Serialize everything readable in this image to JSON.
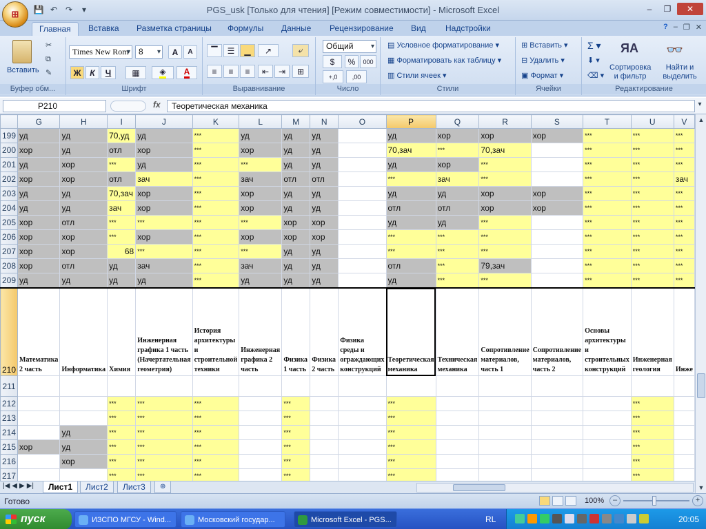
{
  "app": {
    "office_logo": "⊞",
    "title": "PGS_usk  [Только для чтения]  [Режим совместимости] - Microsoft Excel",
    "window_controls": {
      "minimize": "–",
      "restore": "❐",
      "close": "✕"
    },
    "ribbon_controls": {
      "minimize": "–",
      "restore": "❐",
      "close": "✕"
    }
  },
  "quick_access": {
    "save": "💾",
    "undo": "↶",
    "redo": "↷",
    "customize": "▾"
  },
  "tabs": [
    "Главная",
    "Вставка",
    "Разметка страницы",
    "Формулы",
    "Данные",
    "Рецензирование",
    "Вид",
    "Надстройки"
  ],
  "ribbon": {
    "clipboard": {
      "paste": "Вставить",
      "label": "Буфер обм..."
    },
    "font": {
      "name": "Times New Rom",
      "size": "8",
      "bold": "Ж",
      "italic": "К",
      "underline": "Ч",
      "grow": "A",
      "shrink": "A",
      "color": "A",
      "label": "Шрифт"
    },
    "alignment": {
      "label": "Выравнивание"
    },
    "number": {
      "format": "Общий",
      "percent": "%",
      "thousands": "000",
      "label": "Число"
    },
    "styles": {
      "conditional": "Условное форматирование",
      "as_table": "Форматировать как таблицу",
      "cell_styles": "Стили ячеек",
      "label": "Стили"
    },
    "cells": {
      "insert": "Вставить",
      "delete": "Удалить",
      "format": "Формат",
      "label": "Ячейки"
    },
    "editing": {
      "sigma": "Σ",
      "sort": "Сортировка и фильтр",
      "find": "Найти и выделить",
      "label": "Редактирование"
    }
  },
  "formula_bar": {
    "name_box": "P210",
    "fx": "fx",
    "content": "Теоретическая механика"
  },
  "columns": [
    "G",
    "H",
    "I",
    "J",
    "K",
    "L",
    "M",
    "N",
    "O",
    "P",
    "Q",
    "R",
    "S",
    "T",
    "U",
    "V"
  ],
  "selected_column": "P",
  "rows": [
    {
      "n": "199",
      "cells": [
        [
          "уд",
          "gr"
        ],
        [
          "уд",
          "gr"
        ],
        [
          "70,уд",
          "ye"
        ],
        [
          "уд",
          "gr"
        ],
        [
          "***",
          "ye"
        ],
        [
          "уд",
          "gr"
        ],
        [
          "уд",
          "gr"
        ],
        [
          "уд",
          "gr"
        ],
        [
          "",
          ""
        ],
        [
          "уд",
          "gr"
        ],
        [
          "хор",
          "gr"
        ],
        [
          "хор",
          "gr"
        ],
        [
          "хор",
          "gr"
        ],
        [
          "***",
          "ye"
        ],
        [
          "***",
          "ye"
        ],
        [
          "***",
          "ye"
        ]
      ]
    },
    {
      "n": "200",
      "cells": [
        [
          "хор",
          "gr"
        ],
        [
          "уд",
          "gr"
        ],
        [
          "отл",
          "gr"
        ],
        [
          "хор",
          "gr"
        ],
        [
          "***",
          "ye"
        ],
        [
          "хор",
          "gr"
        ],
        [
          "уд",
          "gr"
        ],
        [
          "уд",
          "gr"
        ],
        [
          "",
          ""
        ],
        [
          "70,зач",
          "ye"
        ],
        [
          "***",
          "ye"
        ],
        [
          "70,зач",
          "ye"
        ],
        [
          "",
          ""
        ],
        [
          "***",
          "ye"
        ],
        [
          "***",
          "ye"
        ],
        [
          "***",
          "ye"
        ]
      ]
    },
    {
      "n": "201",
      "cells": [
        [
          "уд",
          "gr"
        ],
        [
          "хор",
          "gr"
        ],
        [
          "***",
          "ye"
        ],
        [
          "уд",
          "gr"
        ],
        [
          "***",
          "ye"
        ],
        [
          "***",
          "ye"
        ],
        [
          "уд",
          "gr"
        ],
        [
          "уд",
          "gr"
        ],
        [
          "",
          ""
        ],
        [
          "уд",
          "gr"
        ],
        [
          "хор",
          "gr"
        ],
        [
          "***",
          "ye"
        ],
        [
          "",
          ""
        ],
        [
          "***",
          "ye"
        ],
        [
          "***",
          "ye"
        ],
        [
          "***",
          "ye"
        ]
      ]
    },
    {
      "n": "202",
      "cells": [
        [
          "хор",
          "gr"
        ],
        [
          "хор",
          "gr"
        ],
        [
          "отл",
          "gr"
        ],
        [
          "зач",
          "ye"
        ],
        [
          "***",
          "ye"
        ],
        [
          "зач",
          "gr"
        ],
        [
          "отл",
          "gr"
        ],
        [
          "отл",
          "gr"
        ],
        [
          "",
          ""
        ],
        [
          "***",
          "ye"
        ],
        [
          "зач",
          "ye"
        ],
        [
          "***",
          "ye"
        ],
        [
          "",
          ""
        ],
        [
          "***",
          "ye"
        ],
        [
          "***",
          "ye"
        ],
        [
          "зач",
          "ye"
        ]
      ]
    },
    {
      "n": "203",
      "cells": [
        [
          "уд",
          "gr"
        ],
        [
          "уд",
          "gr"
        ],
        [
          "70,зач",
          "ye"
        ],
        [
          "хор",
          "gr"
        ],
        [
          "***",
          "ye"
        ],
        [
          "хор",
          "gr"
        ],
        [
          "уд",
          "gr"
        ],
        [
          "уд",
          "gr"
        ],
        [
          "",
          ""
        ],
        [
          "уд",
          "gr"
        ],
        [
          "уд",
          "gr"
        ],
        [
          "хор",
          "gr"
        ],
        [
          "хор",
          "gr"
        ],
        [
          "***",
          "ye"
        ],
        [
          "***",
          "ye"
        ],
        [
          "***",
          "ye"
        ]
      ]
    },
    {
      "n": "204",
      "cells": [
        [
          "уд",
          "gr"
        ],
        [
          "уд",
          "gr"
        ],
        [
          "зач",
          "ye"
        ],
        [
          "хор",
          "gr"
        ],
        [
          "***",
          "ye"
        ],
        [
          "хор",
          "gr"
        ],
        [
          "уд",
          "gr"
        ],
        [
          "уд",
          "gr"
        ],
        [
          "",
          ""
        ],
        [
          "отл",
          "gr"
        ],
        [
          "отл",
          "gr"
        ],
        [
          "хор",
          "gr"
        ],
        [
          "хор",
          "gr"
        ],
        [
          "***",
          "ye"
        ],
        [
          "***",
          "ye"
        ],
        [
          "***",
          "ye"
        ]
      ]
    },
    {
      "n": "205",
      "cells": [
        [
          "хор",
          "gr"
        ],
        [
          "отл",
          "gr"
        ],
        [
          "***",
          "ye"
        ],
        [
          "***",
          "ye"
        ],
        [
          "***",
          "ye"
        ],
        [
          "***",
          "ye"
        ],
        [
          "хор",
          "gr"
        ],
        [
          "хор",
          "gr"
        ],
        [
          "",
          ""
        ],
        [
          "уд",
          "gr"
        ],
        [
          "уд",
          "gr"
        ],
        [
          "***",
          "ye"
        ],
        [
          "",
          ""
        ],
        [
          "***",
          "ye"
        ],
        [
          "***",
          "ye"
        ],
        [
          "***",
          "ye"
        ]
      ]
    },
    {
      "n": "206",
      "cells": [
        [
          "хор",
          "gr"
        ],
        [
          "хор",
          "gr"
        ],
        [
          "***",
          "ye"
        ],
        [
          "хор",
          "gr"
        ],
        [
          "***",
          "ye"
        ],
        [
          "хор",
          "gr"
        ],
        [
          "хор",
          "gr"
        ],
        [
          "хор",
          "gr"
        ],
        [
          "",
          ""
        ],
        [
          "***",
          "ye"
        ],
        [
          "***",
          "ye"
        ],
        [
          "***",
          "ye"
        ],
        [
          "",
          ""
        ],
        [
          "***",
          "ye"
        ],
        [
          "***",
          "ye"
        ],
        [
          "***",
          "ye"
        ]
      ]
    },
    {
      "n": "207",
      "cells": [
        [
          "хор",
          "gr"
        ],
        [
          "хор",
          "gr"
        ],
        [
          "68",
          "ye num"
        ],
        [
          "***",
          "ye"
        ],
        [
          "***",
          "ye"
        ],
        [
          "***",
          "ye"
        ],
        [
          "уд",
          "gr"
        ],
        [
          "уд",
          "gr"
        ],
        [
          "",
          ""
        ],
        [
          "***",
          "ye"
        ],
        [
          "***",
          "ye"
        ],
        [
          "***",
          "ye"
        ],
        [
          "",
          ""
        ],
        [
          "***",
          "ye"
        ],
        [
          "***",
          "ye"
        ],
        [
          "***",
          "ye"
        ]
      ]
    },
    {
      "n": "208",
      "cells": [
        [
          "хор",
          "gr"
        ],
        [
          "отл",
          "gr"
        ],
        [
          "уд",
          "gr"
        ],
        [
          "зач",
          "gr"
        ],
        [
          "***",
          "ye"
        ],
        [
          "зач",
          "gr"
        ],
        [
          "уд",
          "gr"
        ],
        [
          "уд",
          "gr"
        ],
        [
          "",
          ""
        ],
        [
          "отл",
          "gr"
        ],
        [
          "***",
          "ye"
        ],
        [
          "79,зач",
          "gr"
        ],
        [
          "",
          ""
        ],
        [
          "***",
          "ye"
        ],
        [
          "***",
          "ye"
        ],
        [
          "***",
          "ye"
        ]
      ]
    },
    {
      "n": "209",
      "cells": [
        [
          "уд",
          "gr"
        ],
        [
          "уд",
          "gr"
        ],
        [
          "уд",
          "gr"
        ],
        [
          "уд",
          "gr"
        ],
        [
          "***",
          "ye"
        ],
        [
          "уд",
          "gr"
        ],
        [
          "уд",
          "gr"
        ],
        [
          "уд",
          "gr"
        ],
        [
          "",
          ""
        ],
        [
          "уд",
          "gr"
        ],
        [
          "***",
          "ye"
        ],
        [
          "***",
          "ye"
        ],
        [
          "",
          ""
        ],
        [
          "***",
          "ye"
        ],
        [
          "***",
          "ye"
        ],
        [
          "***",
          "ye"
        ]
      ]
    }
  ],
  "header_row": {
    "n": "210",
    "cells": [
      "Математика 2 часть",
      "Информатика",
      "Химия",
      "Инженерная графика 1 часть (Начертательная геометрия)",
      "История архитектуры и строительной техники",
      "Инженерная графика 2 часть",
      "Физика 1 часть",
      "Физика 2 часть",
      "Физика среды и ограждающих конструкций",
      "Теоретическая механика",
      "Техническая механика",
      "Сопротивление материалов, часть 1",
      "Сопротивление материалов, часть 2",
      "Основы архитектуры и строительных конструкций",
      "Инженерная геология",
      "Инже"
    ]
  },
  "lower_rows": [
    {
      "n": "211",
      "cells": [
        [
          "",
          ""
        ],
        [
          "",
          ""
        ],
        [
          "",
          ""
        ],
        [
          "",
          ""
        ],
        [
          "",
          ""
        ],
        [
          "",
          ""
        ],
        [
          "",
          ""
        ],
        [
          "",
          ""
        ],
        [
          "",
          ""
        ],
        [
          "",
          ""
        ],
        [
          "",
          ""
        ],
        [
          "",
          ""
        ],
        [
          "",
          ""
        ],
        [
          "",
          ""
        ],
        [
          "",
          ""
        ],
        [
          "",
          ""
        ]
      ]
    },
    {
      "n": "212",
      "cells": [
        [
          "",
          ""
        ],
        [
          "",
          ""
        ],
        [
          "***",
          "ye"
        ],
        [
          "***",
          "ye"
        ],
        [
          "***",
          "ye"
        ],
        [
          "",
          ""
        ],
        [
          "***",
          "ye"
        ],
        [
          "",
          ""
        ],
        [
          "",
          ""
        ],
        [
          "***",
          "ye"
        ],
        [
          "",
          ""
        ],
        [
          "",
          ""
        ],
        [
          "",
          ""
        ],
        [
          "",
          ""
        ],
        [
          "***",
          "ye"
        ],
        [
          "",
          ""
        ]
      ]
    },
    {
      "n": "213",
      "cells": [
        [
          "",
          ""
        ],
        [
          "",
          ""
        ],
        [
          "***",
          "ye"
        ],
        [
          "***",
          "ye"
        ],
        [
          "***",
          "ye"
        ],
        [
          "",
          ""
        ],
        [
          "***",
          "ye"
        ],
        [
          "",
          ""
        ],
        [
          "",
          ""
        ],
        [
          "***",
          "ye"
        ],
        [
          "",
          ""
        ],
        [
          "",
          ""
        ],
        [
          "",
          ""
        ],
        [
          "",
          ""
        ],
        [
          "***",
          "ye"
        ],
        [
          "",
          ""
        ]
      ]
    },
    {
      "n": "214",
      "cells": [
        [
          "",
          ""
        ],
        [
          "уд",
          "gr"
        ],
        [
          "***",
          "ye"
        ],
        [
          "***",
          "ye"
        ],
        [
          "***",
          "ye"
        ],
        [
          "",
          ""
        ],
        [
          "***",
          "ye"
        ],
        [
          "",
          ""
        ],
        [
          "",
          ""
        ],
        [
          "***",
          "ye"
        ],
        [
          "",
          ""
        ],
        [
          "",
          ""
        ],
        [
          "",
          ""
        ],
        [
          "",
          ""
        ],
        [
          "***",
          "ye"
        ],
        [
          "",
          ""
        ]
      ]
    },
    {
      "n": "215",
      "cells": [
        [
          "хор",
          "gr"
        ],
        [
          "уд",
          "gr"
        ],
        [
          "***",
          "ye"
        ],
        [
          "***",
          "ye"
        ],
        [
          "***",
          "ye"
        ],
        [
          "",
          ""
        ],
        [
          "***",
          "ye"
        ],
        [
          "",
          ""
        ],
        [
          "",
          ""
        ],
        [
          "***",
          "ye"
        ],
        [
          "",
          ""
        ],
        [
          "",
          ""
        ],
        [
          "",
          ""
        ],
        [
          "",
          ""
        ],
        [
          "***",
          "ye"
        ],
        [
          "",
          ""
        ]
      ]
    },
    {
      "n": "216",
      "cells": [
        [
          "",
          ""
        ],
        [
          "хор",
          "gr"
        ],
        [
          "***",
          "ye"
        ],
        [
          "***",
          "ye"
        ],
        [
          "***",
          "ye"
        ],
        [
          "",
          ""
        ],
        [
          "***",
          "ye"
        ],
        [
          "",
          ""
        ],
        [
          "",
          ""
        ],
        [
          "***",
          "ye"
        ],
        [
          "",
          ""
        ],
        [
          "",
          ""
        ],
        [
          "",
          ""
        ],
        [
          "",
          ""
        ],
        [
          "***",
          "ye"
        ],
        [
          "",
          ""
        ]
      ]
    },
    {
      "n": "217",
      "cells": [
        [
          "",
          ""
        ],
        [
          "",
          ""
        ],
        [
          "***",
          "ye"
        ],
        [
          "***",
          "ye"
        ],
        [
          "***",
          "ye"
        ],
        [
          "",
          ""
        ],
        [
          "***",
          "ye"
        ],
        [
          "",
          ""
        ],
        [
          "",
          ""
        ],
        [
          "***",
          "ye"
        ],
        [
          "",
          ""
        ],
        [
          "",
          ""
        ],
        [
          "",
          ""
        ],
        [
          "",
          ""
        ],
        [
          "***",
          "ye"
        ],
        [
          "",
          ""
        ]
      ]
    }
  ],
  "sheets": [
    "Лист1",
    "Лист2",
    "Лист3"
  ],
  "active_sheet": "Лист1",
  "status": {
    "ready": "Готово",
    "zoom": "100%"
  },
  "taskbar": {
    "start": "пуск",
    "items": [
      "ИЗСПО МГСУ - Wind...",
      "Московский государ...",
      "Microsoft Excel - PGS..."
    ],
    "lang": "RL",
    "time": "20:05"
  },
  "colors": {
    "gray_cell": "#bfbfbf",
    "yellow_cell": "#ffff99",
    "selected_header": "#f4c86a"
  }
}
